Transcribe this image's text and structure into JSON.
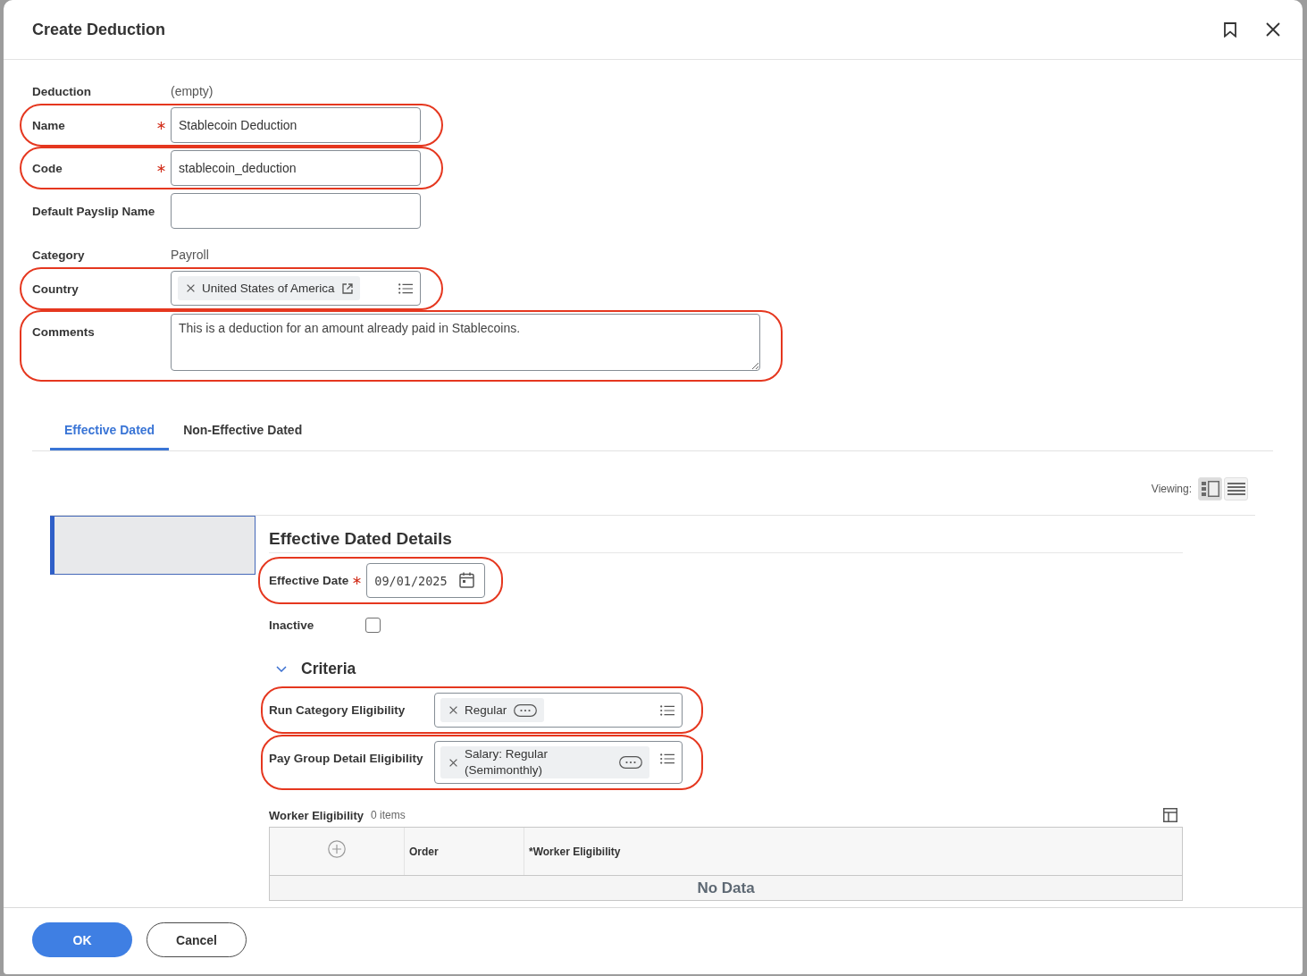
{
  "dialog": {
    "title": "Create Deduction"
  },
  "form": {
    "fields": [
      {
        "kind": "readonly",
        "label": "Deduction",
        "value": "(empty)",
        "required": false,
        "highlighted": false
      },
      {
        "kind": "text",
        "label": "Name",
        "value": "Stablecoin Deduction",
        "required": true,
        "highlighted": true
      },
      {
        "kind": "text",
        "label": "Code",
        "value": "stablecoin_deduction",
        "required": true,
        "highlighted": true
      },
      {
        "kind": "text",
        "label": "Default Payslip Name",
        "required": false,
        "highlighted": false
      },
      {
        "kind": "readonly",
        "label": "Category",
        "value": "Payroll",
        "required": false,
        "highlighted": false
      },
      {
        "kind": "multiselect",
        "label": "Country",
        "tags": [
          {
            "label": "United States of America",
            "kind": "link"
          }
        ],
        "required": false,
        "highlighted": true
      },
      {
        "kind": "textarea",
        "label": "Comments",
        "value": "This is a deduction for an amount already paid in Stablecoins.",
        "required": false,
        "highlighted": true
      }
    ]
  },
  "tabs": [
    {
      "label": "Effective Dated",
      "selected": true
    },
    {
      "label": "Non-Effective Dated",
      "selected": false
    }
  ],
  "viewing": {
    "label": "Viewing:",
    "modes": [
      {
        "kind": "split",
        "selected": true
      },
      {
        "kind": "list",
        "selected": false
      }
    ]
  },
  "effective_dated": {
    "periods": [
      {
        "selected": true
      }
    ],
    "title": "Effective Dated Details",
    "fields": [
      {
        "kind": "date",
        "label": "Effective Date",
        "value": "09/01/2025",
        "required": true,
        "highlighted": true
      },
      {
        "kind": "checkbox",
        "label": "Inactive",
        "checked": false,
        "required": false,
        "highlighted": false
      }
    ],
    "criteria": {
      "title": "Criteria",
      "expanded": true,
      "fields": [
        {
          "kind": "multiselect",
          "label": "Run Category Eligibility",
          "tags": [
            {
              "label": "Regular",
              "kind": "actions"
            }
          ],
          "required": false,
          "highlighted": true
        },
        {
          "kind": "multiselect",
          "label": "Pay Group Detail Eligibility",
          "tags": [
            {
              "label": "Salary: Regular (Semimonthly)",
              "kind": "actions"
            }
          ],
          "required": false,
          "highlighted": true
        }
      ]
    },
    "worker_eligibility": {
      "title": "Worker Eligibility",
      "count": "0 items",
      "columns": [
        {
          "kind": "add"
        },
        {
          "kind": "text",
          "label": "Order"
        },
        {
          "kind": "text",
          "label": "*Worker Eligibility"
        }
      ],
      "empty_text": "No Data"
    }
  },
  "buttons": [
    {
      "label": "OK",
      "kind": "primary"
    },
    {
      "label": "Cancel",
      "kind": "secondary"
    }
  ]
}
